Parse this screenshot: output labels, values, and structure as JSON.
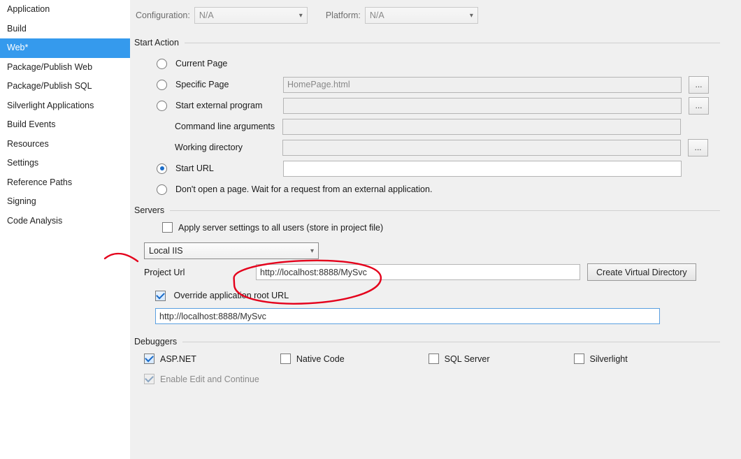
{
  "sidebar": {
    "items": [
      {
        "label": "Application"
      },
      {
        "label": "Build"
      },
      {
        "label": "Web*",
        "selected": true
      },
      {
        "label": "Package/Publish Web"
      },
      {
        "label": "Package/Publish SQL"
      },
      {
        "label": "Silverlight Applications"
      },
      {
        "label": "Build Events"
      },
      {
        "label": "Resources"
      },
      {
        "label": "Settings"
      },
      {
        "label": "Reference Paths"
      },
      {
        "label": "Signing"
      },
      {
        "label": "Code Analysis"
      }
    ]
  },
  "top": {
    "configuration_label": "Configuration:",
    "configuration_value": "N/A",
    "platform_label": "Platform:",
    "platform_value": "N/A"
  },
  "start_action": {
    "title": "Start Action",
    "current_page": "Current Page",
    "specific_page": "Specific Page",
    "specific_page_value": "HomePage.html",
    "start_external": "Start external program",
    "cmd_args": "Command line arguments",
    "working_dir": "Working directory",
    "start_url": "Start URL",
    "dont_open": "Don't open a page.  Wait for a request from an external application.",
    "browse": "..."
  },
  "servers": {
    "title": "Servers",
    "apply_all": "Apply server settings to all users (store in project file)",
    "server_type": "Local IIS",
    "project_url_label": "Project Url",
    "project_url_value": "http://localhost:8888/MySvc",
    "create_vdir": "Create Virtual Directory",
    "override_label": "Override application root URL",
    "override_value": "http://localhost:8888/MySvc"
  },
  "debuggers": {
    "title": "Debuggers",
    "aspnet": "ASP.NET",
    "native": "Native Code",
    "sql": "SQL Server",
    "silverlight": "Silverlight",
    "eec": "Enable Edit and Continue"
  }
}
